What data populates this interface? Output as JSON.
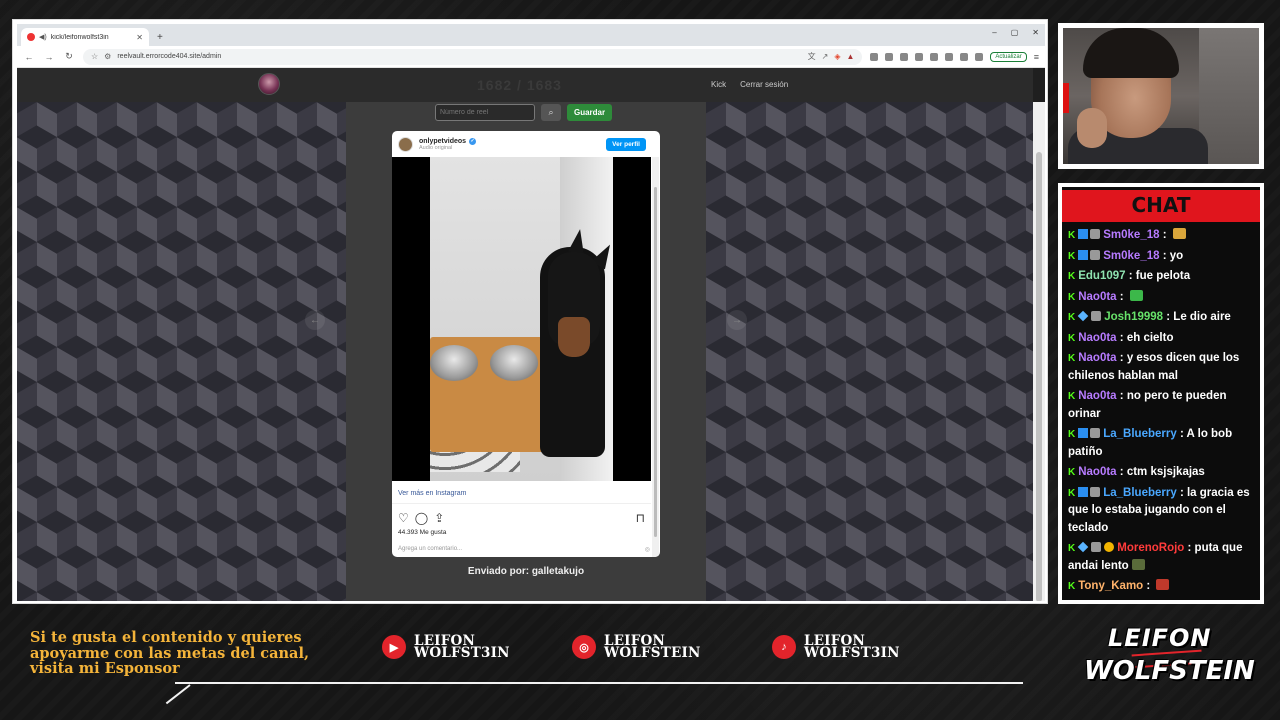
{
  "browser": {
    "tab_title": "kick/leifonwolfst3in",
    "new_tab": "+",
    "url": "reelvault.errorcode404.site/admin",
    "update_label": "Actualizar",
    "win_min": "–",
    "win_max": "▢",
    "win_close": "✕"
  },
  "site": {
    "counter": "1682 / 1683",
    "nav": {
      "kick": "Kick",
      "logout": "Cerrar sesión"
    },
    "reel_input_placeholder": "Número de reel",
    "save_label": "Guardar",
    "sent_by_label": "Enviado por: galletakujo"
  },
  "instagram": {
    "username": "onlypetvideos",
    "audio": "Audio original",
    "profile_button": "Ver perfil",
    "more_link": "Ver más en Instagram",
    "likes": "44.393 Me gusta",
    "comment_placeholder": "Agrega un comentario..."
  },
  "chat": {
    "title": "CHAT",
    "messages": [
      {
        "user": "Sm0ke_18",
        "color": "#b77bff",
        "text": "",
        "badges": [
          "kick",
          "sub",
          "gift"
        ],
        "emote": "#d9a63b"
      },
      {
        "user": "Sm0ke_18",
        "color": "#b77bff",
        "text": "yo",
        "badges": [
          "kick",
          "sub",
          "gift"
        ]
      },
      {
        "user": "Edu1097",
        "color": "#8fe3b0",
        "text": "fue pelota",
        "badges": [
          "kick"
        ]
      },
      {
        "user": "Nao0ta",
        "color": "#b77bff",
        "text": "",
        "badges": [
          "kick"
        ],
        "emote": "#3cb84a"
      },
      {
        "user": "Josh19998",
        "color": "#67e26a",
        "text": "Le dio aire",
        "badges": [
          "kick",
          "gem",
          "gift"
        ]
      },
      {
        "user": "Nao0ta",
        "color": "#b77bff",
        "text": "eh cielto",
        "badges": [
          "kick"
        ]
      },
      {
        "user": "Nao0ta",
        "color": "#b77bff",
        "text": "y esos dicen que los chilenos hablan mal",
        "badges": [
          "kick"
        ]
      },
      {
        "user": "Nao0ta",
        "color": "#b77bff",
        "text": "no pero te pueden orinar",
        "badges": [
          "kick"
        ]
      },
      {
        "user": "La_Blueberry",
        "color": "#4aa8ff",
        "text": "A lo bob patiño",
        "badges": [
          "kick",
          "sub",
          "gift"
        ]
      },
      {
        "user": "Nao0ta",
        "color": "#b77bff",
        "text": "ctm ksjsjkajas",
        "badges": [
          "kick"
        ]
      },
      {
        "user": "La_Blueberry",
        "color": "#4aa8ff",
        "text": "la gracia es que lo estaba jugando con el teclado",
        "badges": [
          "kick",
          "sub",
          "gift"
        ]
      },
      {
        "user": "MorenoRojo",
        "color": "#ff3b3b",
        "text": "puta que andai lento",
        "badges": [
          "kick",
          "gem",
          "gift",
          "gold"
        ],
        "emote": "#5a6b3a"
      },
      {
        "user": "Tony_Kamo",
        "color": "#ffb36b",
        "text": "",
        "badges": [
          "kick"
        ],
        "emote": "#c0392b"
      }
    ]
  },
  "footer": {
    "message": "Si te gusta el contenido y quieres apoyarme con las metas del canal, visita mi Esponsor",
    "youtube": {
      "line1": "LEIFON",
      "line2": "WOLFST3IN"
    },
    "instagram": {
      "line1": "LEIFON",
      "line2": "WOLFSTEIN"
    },
    "tiktok": {
      "line1": "LEIFON",
      "line2": "WOLFST3IN"
    },
    "brand_line1": "LEIFON",
    "brand_line2": "WOLFSTEIN"
  }
}
